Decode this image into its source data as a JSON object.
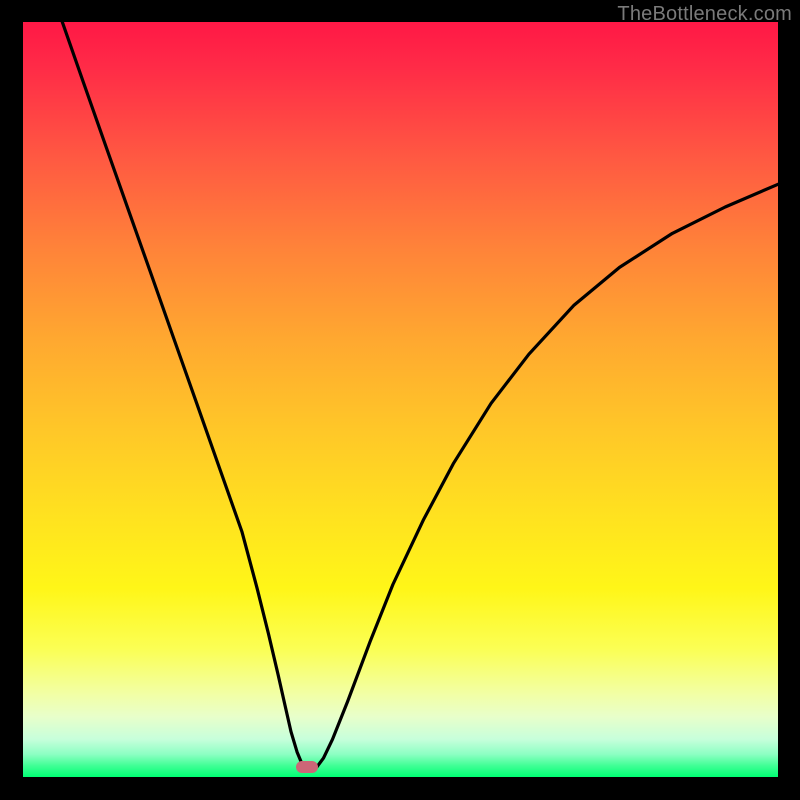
{
  "watermark": {
    "text": "TheBottleneck.com"
  },
  "colors": {
    "frame": "#000000",
    "curve": "#000000",
    "marker": "#cc6677",
    "watermark": "#7a7a7a",
    "gradient_stops": [
      "#ff1846",
      "#ff2b47",
      "#ff5942",
      "#ff8339",
      "#ffa830",
      "#ffc728",
      "#ffe31f",
      "#fff618",
      "#fbff54",
      "#f2ffa5",
      "#e8ffca",
      "#c7ffdb",
      "#8cffc3",
      "#40ff95",
      "#00ff73"
    ]
  },
  "marker": {
    "x_frac": 0.376,
    "y_frac": 0.987
  },
  "chart_data": {
    "type": "line",
    "title": "",
    "xlabel": "",
    "ylabel": "",
    "xlim": [
      0,
      100
    ],
    "ylim": [
      0,
      100
    ],
    "grid": false,
    "legend": false,
    "series": [
      {
        "name": "bottleneck-curve",
        "x": [
          5.2,
          8,
          11,
          14,
          17,
          20,
          23,
          26,
          29,
          31,
          32.5,
          33.8,
          34.7,
          35.5,
          36.3,
          37.0,
          37.6,
          38.9,
          39.8,
          41,
          43,
          46,
          49,
          53,
          57,
          62,
          67,
          73,
          79,
          86,
          93,
          100
        ],
        "y": [
          100,
          92,
          83.5,
          75,
          66.5,
          58,
          49.5,
          41,
          32.5,
          25,
          19,
          13.5,
          9.5,
          6,
          3.3,
          1.6,
          1.3,
          1.3,
          2.5,
          5,
          10,
          18,
          25.5,
          34,
          41.5,
          49.5,
          56,
          62.5,
          67.5,
          72,
          75.5,
          78.5
        ]
      }
    ],
    "marker_point": {
      "x": 37.6,
      "y": 1.3
    }
  }
}
